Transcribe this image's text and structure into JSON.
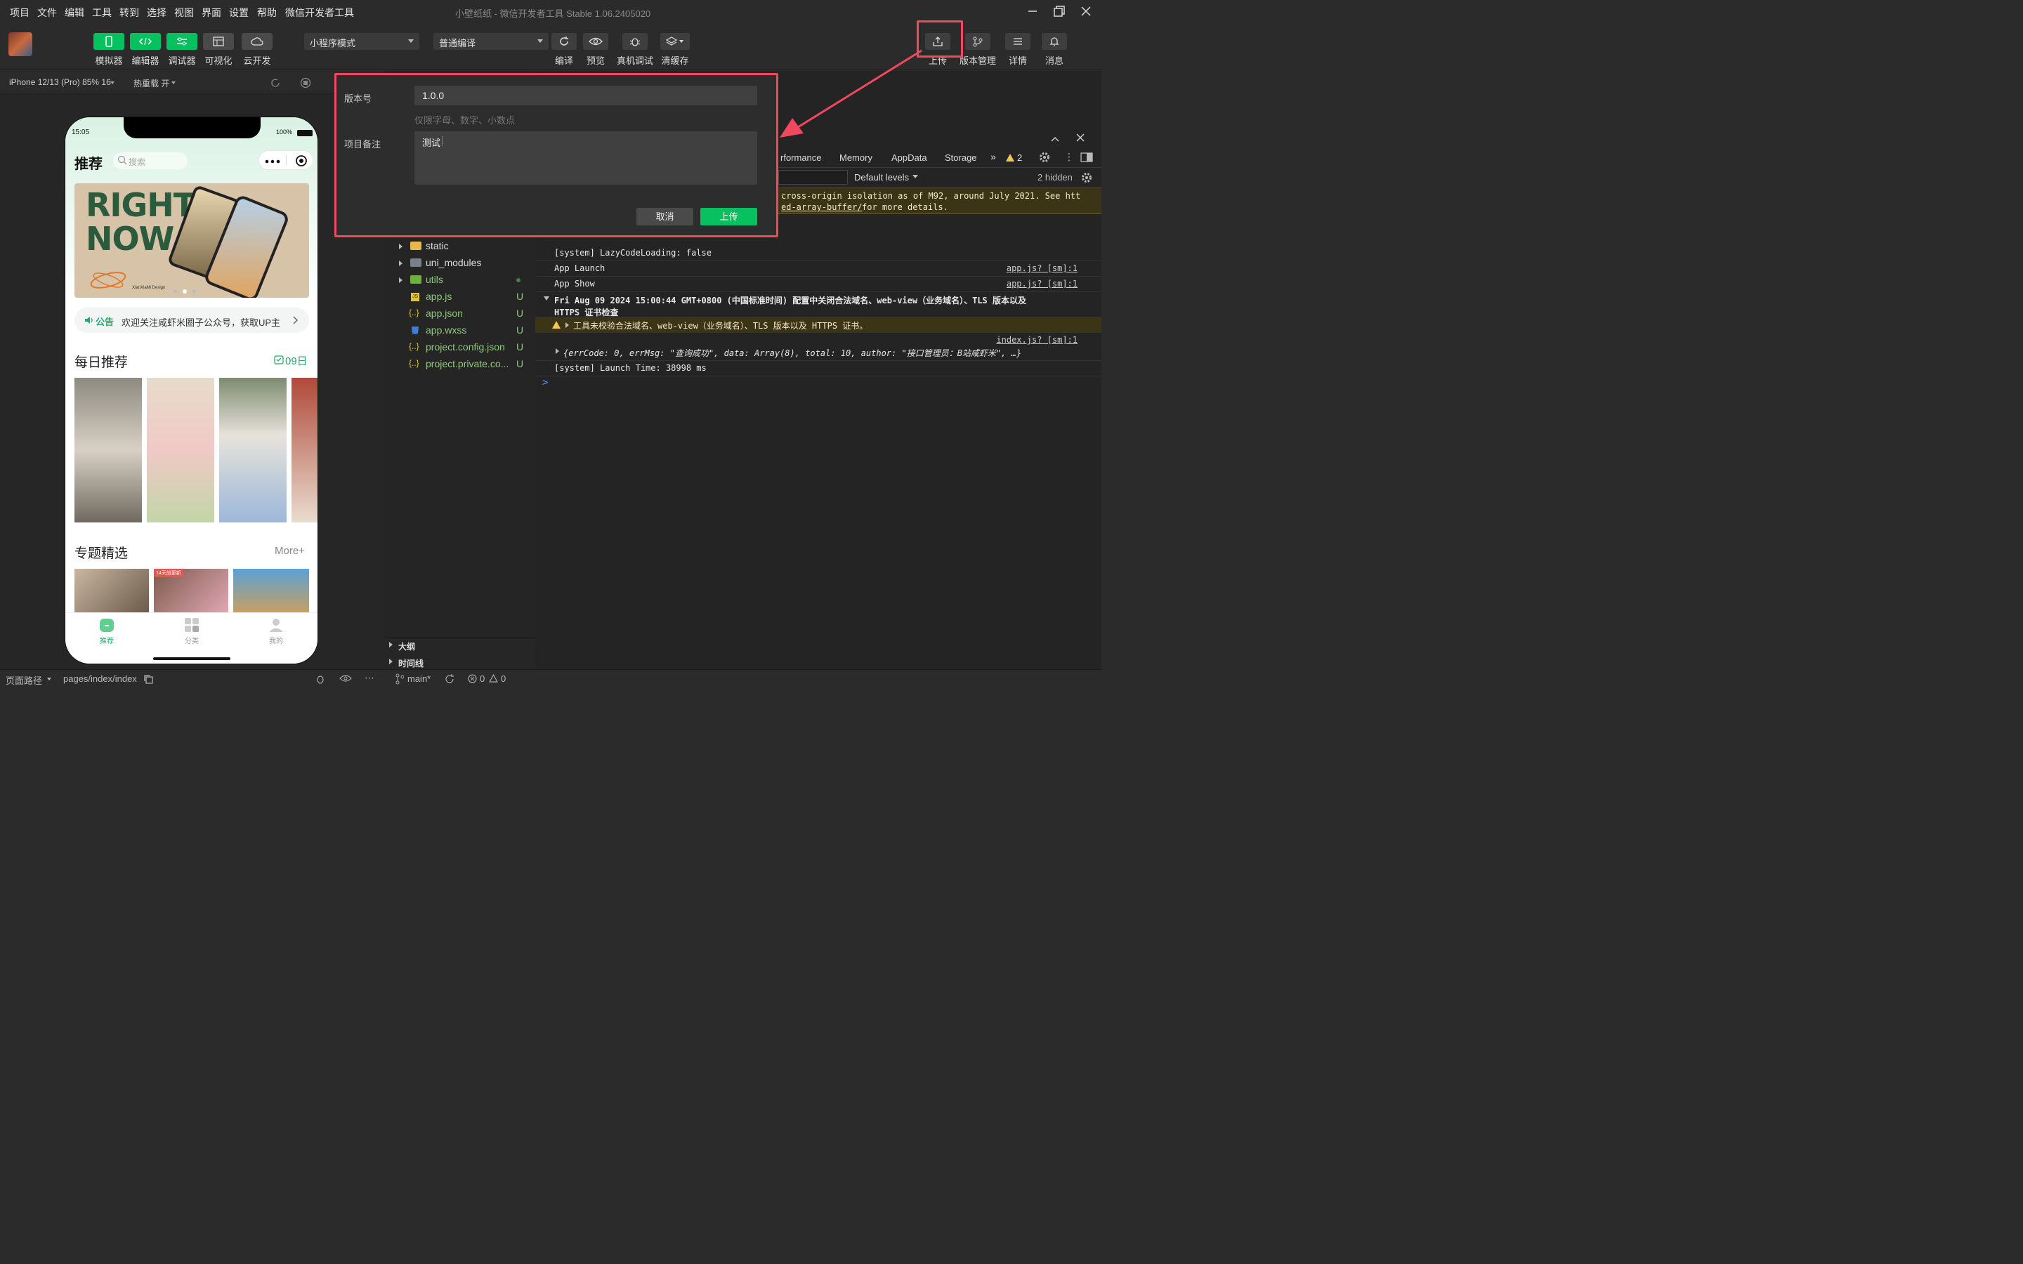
{
  "menubar": {
    "items": [
      "项目",
      "文件",
      "编辑",
      "工具",
      "转到",
      "选择",
      "视图",
      "界面",
      "设置",
      "帮助",
      "微信开发者工具"
    ],
    "window_title": "小壁纸纸 - 微信开发者工具 Stable 1.06.2405020"
  },
  "toolbar": {
    "left_buttons": [
      {
        "label": "模拟器",
        "icon": "phone-icon"
      },
      {
        "label": "编辑器",
        "icon": "code-icon"
      },
      {
        "label": "调试器",
        "icon": "debug-sliders-icon"
      },
      {
        "label": "可视化",
        "icon": "layout-icon"
      },
      {
        "label": "云开发",
        "icon": "cloud-icon"
      }
    ],
    "mode_select": "小程序模式",
    "compile_select": "普通编译",
    "mid_buttons": [
      {
        "label": "编译",
        "icon": "refresh-icon"
      },
      {
        "label": "预览",
        "icon": "eye-icon"
      },
      {
        "label": "真机调试",
        "icon": "bug-icon"
      },
      {
        "label": "清缓存",
        "icon": "layers-icon"
      }
    ],
    "right_buttons": [
      {
        "label": "上传",
        "icon": "upload-icon"
      },
      {
        "label": "版本管理",
        "icon": "branch-icon"
      },
      {
        "label": "详情",
        "icon": "menu-icon"
      },
      {
        "label": "消息",
        "icon": "bell-icon"
      }
    ]
  },
  "simulator_bar": {
    "device": "iPhone 12/13 (Pro) 85% 16",
    "hot_reload": "热重载 开"
  },
  "phone": {
    "time": "15:05",
    "battery": "100%",
    "page_title": "推荐",
    "search_placeholder": "搜索",
    "banner_text_top": "RIGHT",
    "banner_text_bottom": "NOW",
    "banner_caption": "XianXiaMi Design",
    "notice_label": "公告",
    "notice_text": "欢迎关注咸虾米圈子公众号，获取UP主",
    "daily_title": "每日推荐",
    "daily_date": "09日",
    "topic_title": "专题精选",
    "topic_more": "More+",
    "topic_badge": "14天前更新",
    "tabs": [
      "推荐",
      "分类",
      "我的"
    ]
  },
  "file_tree": {
    "items": [
      {
        "name": "static",
        "type": "folder",
        "status": ""
      },
      {
        "name": "uni_modules",
        "type": "folder",
        "status": ""
      },
      {
        "name": "utils",
        "type": "folder",
        "status": "•"
      },
      {
        "name": "app.js",
        "type": "js",
        "status": "U"
      },
      {
        "name": "app.json",
        "type": "json",
        "status": "U"
      },
      {
        "name": "app.wxss",
        "type": "css",
        "status": "U"
      },
      {
        "name": "project.config.json",
        "type": "json",
        "status": "U"
      },
      {
        "name": "project.private.co...",
        "type": "json",
        "status": "U"
      }
    ],
    "outline_label": "大纲",
    "timeline_label": "时间线"
  },
  "devtools": {
    "tabs": [
      "rformance",
      "Memory",
      "AppData",
      "Storage"
    ],
    "warning_count": "2",
    "levels": "Default levels",
    "hidden": "2 hidden",
    "banner_line1": "cross-origin isolation as of M92, around July 2021. See htt",
    "banner_line2a": "ed-array-buffer/",
    "banner_line2b": " for more details.",
    "logs": [
      {
        "text": "[system] LazyCodeLoading: false",
        "link": ""
      },
      {
        "text": "App Launch",
        "link": "app.js? [sm]:1"
      },
      {
        "text": "App Show",
        "link": "app.js? [sm]:1"
      },
      {
        "text": "Fri Aug 09 2024 15:00:44 GMT+0800 (中国标准时间) 配置中关闭合法域名、web-view（业务域名）、TLS 版本以及",
        "link": ""
      },
      {
        "text": "HTTPS 证书检查",
        "link": ""
      },
      {
        "text": "工具未校验合法域名、web-view（业务域名）、TLS 版本以及 HTTPS 证书。",
        "link": ""
      },
      {
        "text": "index.js? [sm]:1",
        "link": ""
      },
      {
        "text": "{errCode: 0, errMsg: \"查询成功\", data: Array(8), total: 10, author: \"接口管理员：B站咸虾米\", …}",
        "link": ""
      },
      {
        "text": "[system] Launch Time: 38998 ms",
        "link": ""
      }
    ],
    "prompt": ">"
  },
  "dialog": {
    "version_label": "版本号",
    "version_value": "1.0.0",
    "version_hint": "仅限字母、数字、小数点",
    "note_label": "项目备注",
    "note_value": "测试",
    "cancel_label": "取消",
    "upload_label": "上传"
  },
  "statusbar": {
    "page_path_label": "页面路径",
    "page_path": "pages/index/index",
    "branch": "main*",
    "errors": "0",
    "warnings": "0"
  },
  "colors": {
    "accent_green": "#07c160",
    "highlight_red": "#f0485e",
    "warn_bg": "#3b3416"
  }
}
